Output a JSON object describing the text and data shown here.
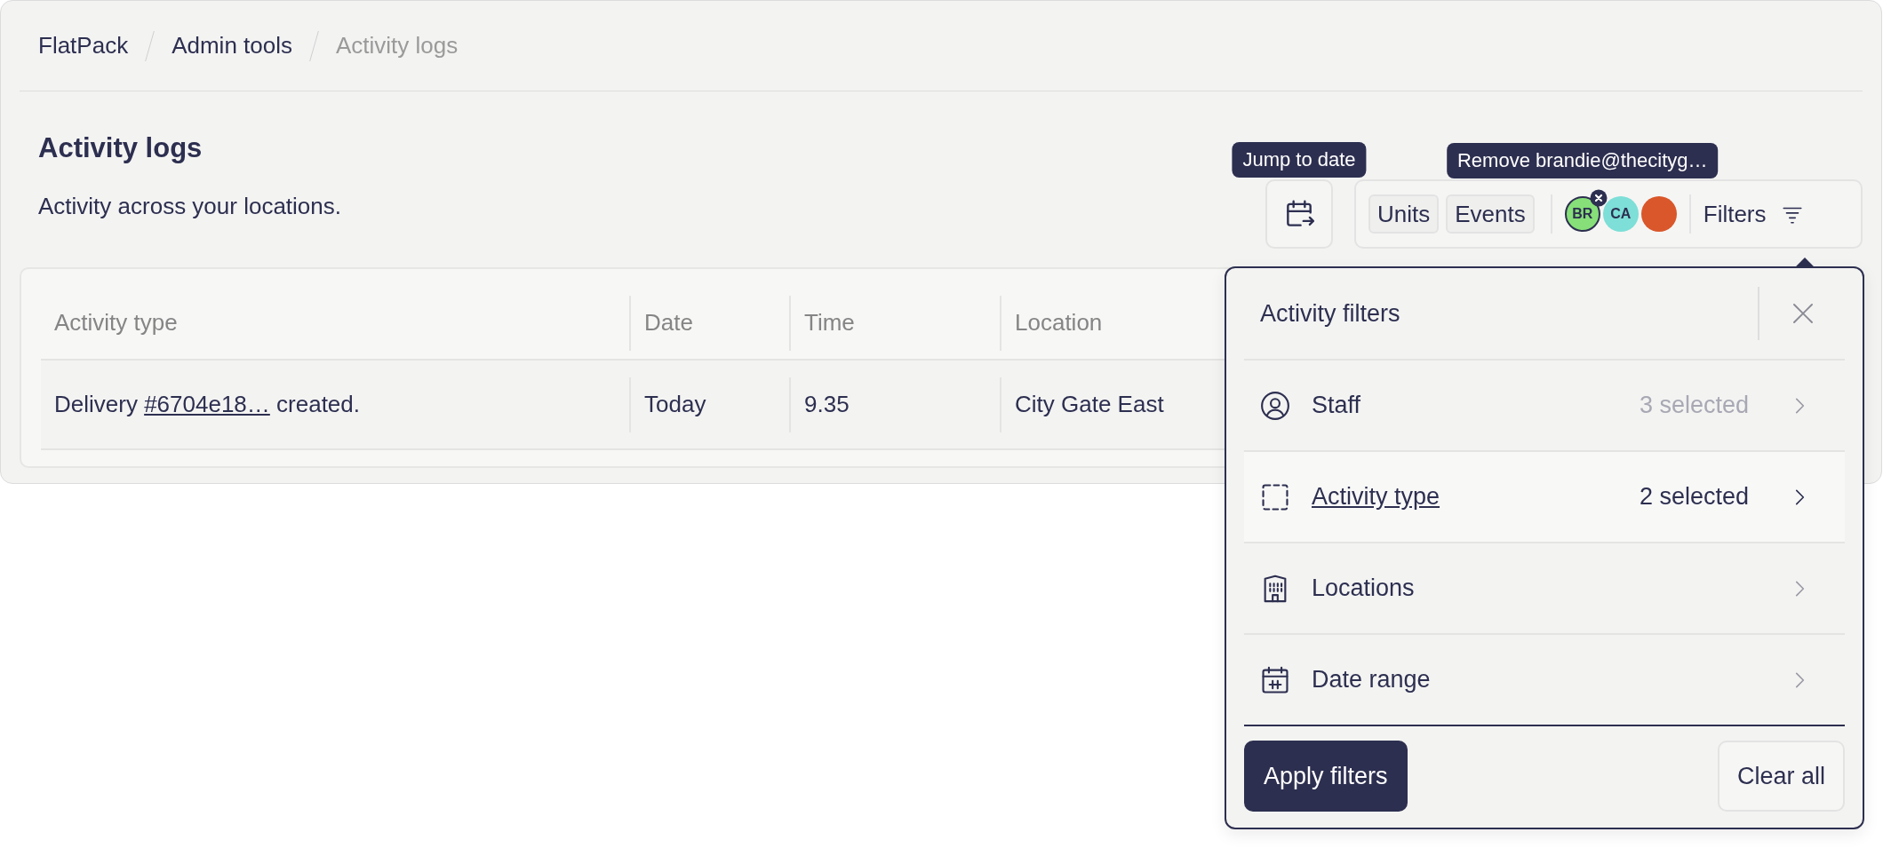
{
  "breadcrumb": [
    {
      "label": "FlatPack",
      "current": false
    },
    {
      "label": "Admin tools",
      "current": false
    },
    {
      "label": "Activity logs",
      "current": true
    }
  ],
  "page": {
    "title": "Activity logs",
    "subtitle": "Activity across your locations."
  },
  "toolbar": {
    "jump_button": {
      "tooltip": "Jump to date"
    },
    "chips": [
      "Units",
      "Events"
    ],
    "avatars": [
      {
        "kind": "initials",
        "initials": "BR",
        "color": "#86df78",
        "removable": true,
        "tooltip": "Remove brandie@thecityg…"
      },
      {
        "kind": "initials",
        "initials": "CA",
        "color": "#7ddfd7",
        "removable": false
      },
      {
        "kind": "photo",
        "color": "#d9572a",
        "removable": false
      }
    ],
    "filters_button": "Filters"
  },
  "table": {
    "columns": [
      "Activity type",
      "Date",
      "Time",
      "Location"
    ],
    "rows": [
      {
        "activity": {
          "text_before": "Delivery",
          "link": "#6704e18…",
          "text_after": "created."
        },
        "date": "Today",
        "time": "9.35",
        "location": "City Gate East"
      }
    ]
  },
  "filter_panel": {
    "title": "Activity filters",
    "items": [
      {
        "kind": "staff",
        "label": "Staff",
        "count": "3 selected",
        "selected": false
      },
      {
        "kind": "activity_type",
        "label": "Activity type",
        "count": "2 selected",
        "selected": true
      },
      {
        "kind": "locations",
        "label": "Locations",
        "selected": false
      },
      {
        "kind": "date_range",
        "label": "Date range",
        "selected": false
      }
    ],
    "apply_button": "Apply filters",
    "clear_button": "Clear all"
  }
}
